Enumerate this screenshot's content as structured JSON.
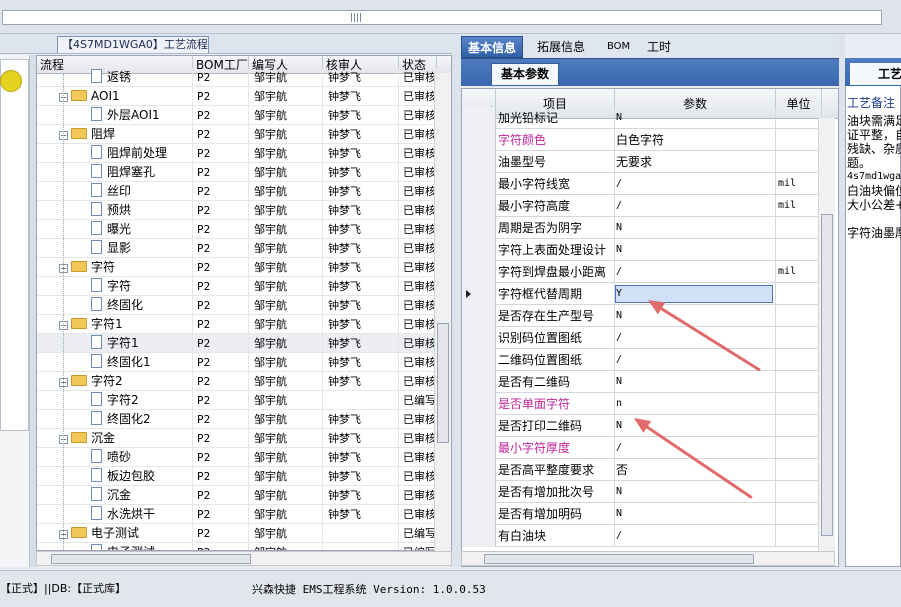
{
  "left_panel": {
    "title": "【4S7MD1WGA0】工艺流程",
    "columns": [
      "流程",
      "BOM工厂",
      "编写人",
      "核审人",
      "状态"
    ],
    "rows": [
      {
        "name": "返锈",
        "kind": "doc",
        "level": 2,
        "bom": "P2",
        "writer": "邹宇航",
        "reviewer": "钟梦飞",
        "status": "已审核"
      },
      {
        "name": "AOI1",
        "kind": "folder",
        "level": 1,
        "bom": "P2",
        "writer": "邹宇航",
        "reviewer": "钟梦飞",
        "status": "已审核"
      },
      {
        "name": "外层AOI1",
        "kind": "doc",
        "level": 2,
        "bom": "P2",
        "writer": "邹宇航",
        "reviewer": "钟梦飞",
        "status": "已审核"
      },
      {
        "name": "阻焊",
        "kind": "folder",
        "level": 1,
        "bom": "P2",
        "writer": "邹宇航",
        "reviewer": "钟梦飞",
        "status": "已审核"
      },
      {
        "name": "阻焊前处理",
        "kind": "doc",
        "level": 2,
        "bom": "P2",
        "writer": "邹宇航",
        "reviewer": "钟梦飞",
        "status": "已审核"
      },
      {
        "name": "阻焊塞孔",
        "kind": "doc",
        "level": 2,
        "bom": "P2",
        "writer": "邹宇航",
        "reviewer": "钟梦飞",
        "status": "已审核"
      },
      {
        "name": "丝印",
        "kind": "doc",
        "level": 2,
        "bom": "P2",
        "writer": "邹宇航",
        "reviewer": "钟梦飞",
        "status": "已审核"
      },
      {
        "name": "预烘",
        "kind": "doc",
        "level": 2,
        "bom": "P2",
        "writer": "邹宇航",
        "reviewer": "钟梦飞",
        "status": "已审核"
      },
      {
        "name": "曝光",
        "kind": "doc",
        "level": 2,
        "bom": "P2",
        "writer": "邹宇航",
        "reviewer": "钟梦飞",
        "status": "已审核"
      },
      {
        "name": "显影",
        "kind": "doc",
        "level": 2,
        "bom": "P2",
        "writer": "邹宇航",
        "reviewer": "钟梦飞",
        "status": "已审核"
      },
      {
        "name": "字符",
        "kind": "folder",
        "level": 1,
        "bom": "P2",
        "writer": "邹宇航",
        "reviewer": "钟梦飞",
        "status": "已审核"
      },
      {
        "name": "字符",
        "kind": "doc",
        "level": 2,
        "bom": "P2",
        "writer": "邹宇航",
        "reviewer": "钟梦飞",
        "status": "已审核"
      },
      {
        "name": "终固化",
        "kind": "doc",
        "level": 2,
        "bom": "P2",
        "writer": "邹宇航",
        "reviewer": "钟梦飞",
        "status": "已审核"
      },
      {
        "name": "字符1",
        "kind": "folder",
        "level": 1,
        "bom": "P2",
        "writer": "邹宇航",
        "reviewer": "钟梦飞",
        "status": "已审核"
      },
      {
        "name": "字符1",
        "kind": "doc",
        "level": 2,
        "bom": "P2",
        "writer": "邹宇航",
        "reviewer": "钟梦飞",
        "status": "已审核"
      },
      {
        "name": "终固化1",
        "kind": "doc",
        "level": 2,
        "bom": "P2",
        "writer": "邹宇航",
        "reviewer": "钟梦飞",
        "status": "已审核"
      },
      {
        "name": "字符2",
        "kind": "folder",
        "level": 1,
        "bom": "P2",
        "writer": "邹宇航",
        "reviewer": "钟梦飞",
        "status": "已审核"
      },
      {
        "name": "字符2",
        "kind": "doc",
        "level": 2,
        "bom": "P2",
        "writer": "邹宇航",
        "reviewer": "",
        "status": "已编写"
      },
      {
        "name": "终固化2",
        "kind": "doc",
        "level": 2,
        "bom": "P2",
        "writer": "邹宇航",
        "reviewer": "钟梦飞",
        "status": "已审核"
      },
      {
        "name": "沉金",
        "kind": "folder",
        "level": 1,
        "bom": "P2",
        "writer": "邹宇航",
        "reviewer": "钟梦飞",
        "status": "已审核"
      },
      {
        "name": "喷砂",
        "kind": "doc",
        "level": 2,
        "bom": "P2",
        "writer": "邹宇航",
        "reviewer": "钟梦飞",
        "status": "已审核"
      },
      {
        "name": "板边包胶",
        "kind": "doc",
        "level": 2,
        "bom": "P2",
        "writer": "邹宇航",
        "reviewer": "钟梦飞",
        "status": "已审核"
      },
      {
        "name": "沉金",
        "kind": "doc",
        "level": 2,
        "bom": "P2",
        "writer": "邹宇航",
        "reviewer": "钟梦飞",
        "status": "已审核"
      },
      {
        "name": "水洗烘干",
        "kind": "doc",
        "level": 2,
        "bom": "P2",
        "writer": "邹宇航",
        "reviewer": "钟梦飞",
        "status": "已审核"
      },
      {
        "name": "电子测试",
        "kind": "folder",
        "level": 1,
        "bom": "P2",
        "writer": "邹宇航",
        "reviewer": "",
        "status": "已编写"
      },
      {
        "name": "电子测试",
        "kind": "doc",
        "level": 2,
        "bom": "P2",
        "writer": "邹宇航",
        "reviewer": "",
        "status": "已编写"
      }
    ],
    "selected_row": 14
  },
  "tabs": [
    "基本信息",
    "拓展信息",
    "BOM",
    "工时"
  ],
  "active_tab": 0,
  "subtab": "基本参数",
  "grid": {
    "columns": [
      "项目",
      "参数",
      "单位"
    ],
    "rows": [
      {
        "item": "加光铅标记",
        "param": "N",
        "unit": "",
        "color": "#000000"
      },
      {
        "item": "字符颜色",
        "param": "白色字符",
        "unit": "",
        "color": "#c0249b"
      },
      {
        "item": "油墨型号",
        "param": "无要求",
        "unit": "",
        "color": "#000000"
      },
      {
        "item": "最小字符线宽",
        "param": "/",
        "unit": "mil",
        "color": "#000000"
      },
      {
        "item": "最小字符高度",
        "param": "/",
        "unit": "mil",
        "color": "#000000"
      },
      {
        "item": "周期是否为阴字",
        "param": "N",
        "unit": "",
        "color": "#000000"
      },
      {
        "item": "字符上表面处理设计",
        "param": "N",
        "unit": "",
        "color": "#000000"
      },
      {
        "item": "字符到焊盘最小距离",
        "param": "/",
        "unit": "mil",
        "color": "#000000"
      },
      {
        "item": "字符框代替周期",
        "param": "Y",
        "unit": "",
        "color": "#000000"
      },
      {
        "item": "是否存在生产型号",
        "param": "N",
        "unit": "",
        "color": "#000000"
      },
      {
        "item": "识别码位置图纸",
        "param": "/",
        "unit": "",
        "color": "#000000"
      },
      {
        "item": "二维码位置图纸",
        "param": "/",
        "unit": "",
        "color": "#000000"
      },
      {
        "item": "是否有二维码",
        "param": "N",
        "unit": "",
        "color": "#000000"
      },
      {
        "item": "是否单面字符",
        "param": "n",
        "unit": "",
        "color": "#c0249b"
      },
      {
        "item": "是否打印二维码",
        "param": "N",
        "unit": "",
        "color": "#000000"
      },
      {
        "item": "最小字符厚度",
        "param": "/",
        "unit": "",
        "color": "#c0249b"
      },
      {
        "item": "是否高平整度要求",
        "param": "否",
        "unit": "",
        "color": "#000000"
      },
      {
        "item": "是否有增加批次号",
        "param": "N",
        "unit": "",
        "color": "#000000"
      },
      {
        "item": "是否有增加明码",
        "param": "N",
        "unit": "",
        "color": "#000000"
      },
      {
        "item": "有白油块",
        "param": "/",
        "unit": "",
        "color": "#000000"
      }
    ],
    "current_row": 8
  },
  "right_panel": {
    "tab": "工艺",
    "label": "工艺备注",
    "lines": [
      "油块需满足",
      "证平整，自",
      "残缺、杂质",
      "题。",
      "4s7md1wga0",
      "白油块偏位",
      "大小公差+",
      "",
      "字符油墨厚"
    ]
  },
  "status": {
    "left": "【正式】||DB:【正式库】",
    "app": "兴森快捷 EMS工程系统 Version: 1.0.0.53"
  },
  "annotation": {
    "arrow_color": "#e06b6b"
  }
}
